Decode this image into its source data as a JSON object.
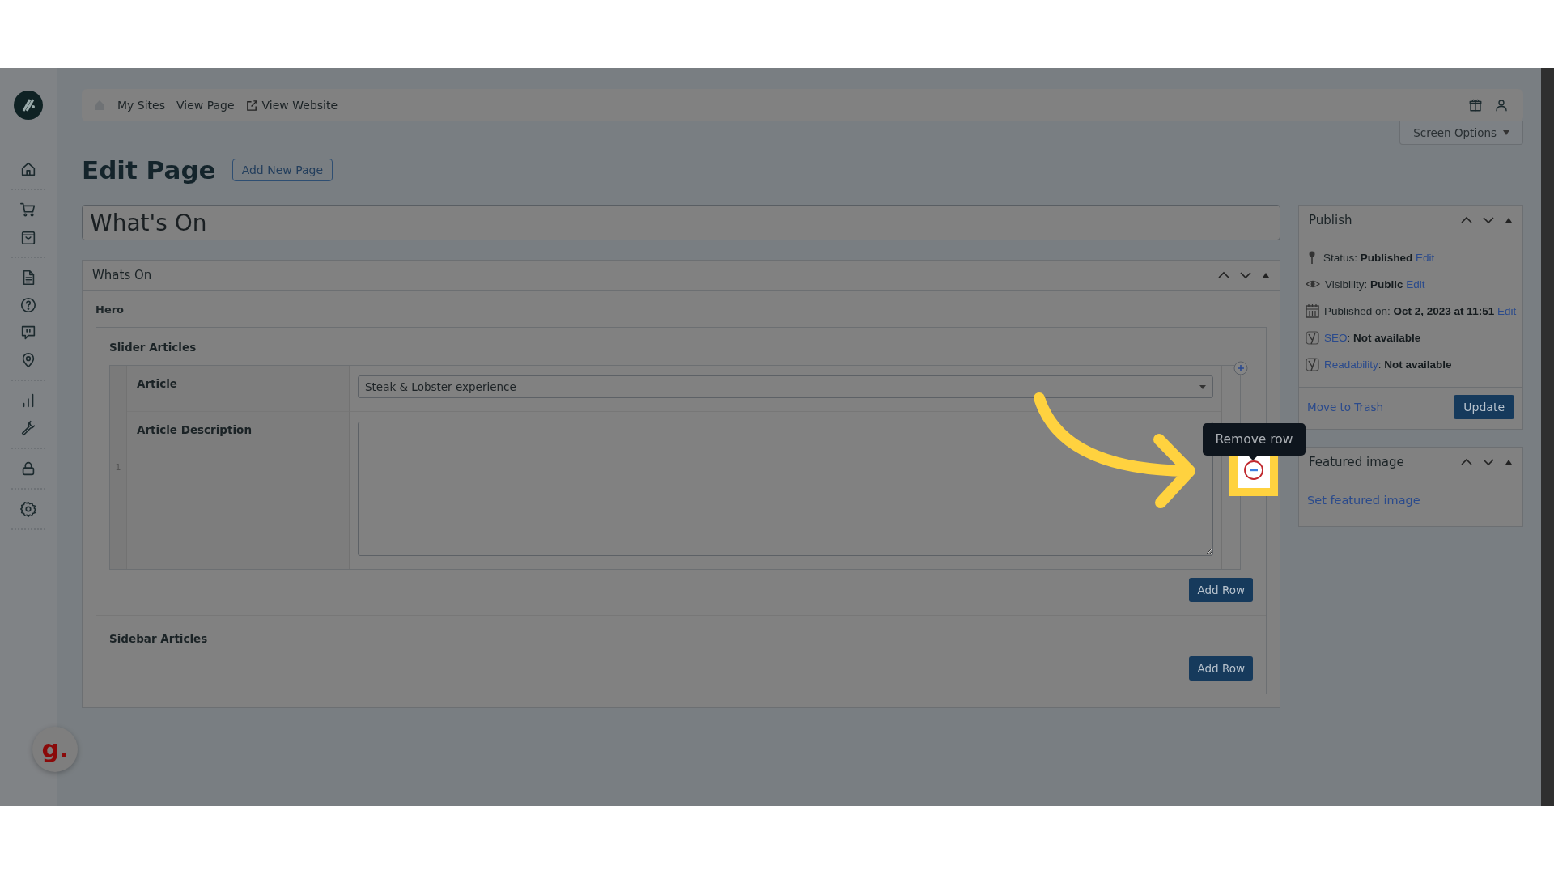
{
  "top_bar": {
    "links": [
      {
        "label": "My Sites",
        "external": false
      },
      {
        "label": "View Page",
        "external": false
      },
      {
        "label": "View Website",
        "external": true
      }
    ]
  },
  "screen_options": "Screen Options",
  "page_heading": "Edit Page",
  "add_new_button": "Add New Page",
  "title_field": {
    "value": "What's On"
  },
  "metabox": {
    "title": "Whats On",
    "group_label": "Hero",
    "repeaters": [
      {
        "label": "Slider Articles",
        "rows": [
          {
            "index": "1",
            "fields": [
              {
                "kind": "select",
                "label": "Article",
                "value": "Steak & Lobster experience"
              },
              {
                "kind": "textarea",
                "label": "Article Description"
              }
            ]
          }
        ],
        "add_button": "Add Row"
      },
      {
        "label": "Sidebar Articles",
        "add_button": "Add Row"
      }
    ]
  },
  "tooltip": "Remove row",
  "publish": {
    "title": "Publish",
    "items": [
      {
        "kind": "status",
        "parts": [
          {
            "kind": "text",
            "text": "Status: **Published**"
          },
          {
            "kind": "link",
            "text": "Edit"
          }
        ]
      },
      {
        "kind": "visibility",
        "parts": [
          {
            "kind": "text",
            "text": "Visibility: **Public**"
          },
          {
            "kind": "link",
            "text": "Edit"
          }
        ]
      },
      {
        "kind": "date",
        "parts": [
          {
            "kind": "text",
            "text": "Published on: **Oct 2, 2023 at 11:51**"
          },
          {
            "kind": "link",
            "text": "Edit"
          }
        ]
      },
      {
        "kind": "yoast",
        "parts": [
          {
            "kind": "link",
            "text": "SEO"
          },
          {
            "kind": "text",
            "text": ": **Not available**"
          }
        ]
      },
      {
        "kind": "yoast",
        "parts": [
          {
            "kind": "link",
            "text": "Readability"
          },
          {
            "kind": "text",
            "text": ": **Not available**"
          }
        ]
      }
    ],
    "trash": "Move to Trash",
    "update": "Update"
  },
  "featured_image": {
    "title": "Featured image",
    "link": "Set featured image"
  },
  "help_widget": "g."
}
